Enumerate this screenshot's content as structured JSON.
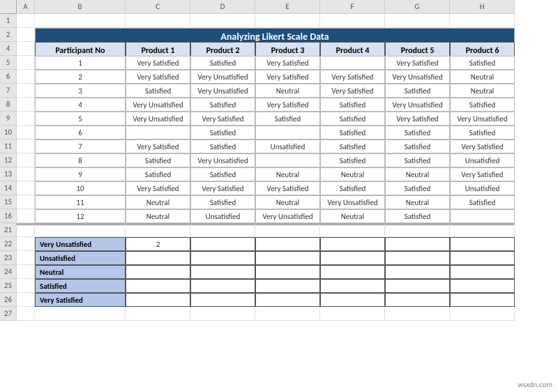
{
  "cols": [
    "A",
    "B",
    "C",
    "D",
    "E",
    "F",
    "G",
    "H"
  ],
  "title": "Analyzing Likert Scale Data",
  "headers": [
    "Participant No",
    "Product 1",
    "Product 2",
    "Product 3",
    "Product 4",
    "Product 5",
    "Product 6"
  ],
  "rows": [
    {
      "n": "1",
      "c": [
        "Very Satisfied",
        "Satisfied",
        "Very Satisfied",
        "",
        "Very Satisfied",
        "Satisfied"
      ]
    },
    {
      "n": "2",
      "c": [
        "Very Satisfied",
        "Very Unsatisfied",
        "Very Satisfied",
        "Very Satisfied",
        "Very Unsatisfied",
        "Neutral"
      ]
    },
    {
      "n": "3",
      "c": [
        "Satisfied",
        "Very Unsatisfied",
        "Neutral",
        "Very Satisfied",
        "Satisfied",
        "Neutral"
      ]
    },
    {
      "n": "4",
      "c": [
        "Very Unsatisfied",
        "Satisfied",
        "Very Satisfied",
        "Satisfied",
        "Very Unsatisfied",
        "Satisfied"
      ]
    },
    {
      "n": "5",
      "c": [
        "Very Unsatisfied",
        "Very Satisfied",
        "Satisfied",
        "Satisfied",
        "Very Satisfied",
        "Very Unsatisfied"
      ]
    },
    {
      "n": "6",
      "c": [
        "",
        "Satisfied",
        "",
        "Satisfied",
        "Satisfied",
        "Satisfied"
      ]
    },
    {
      "n": "7",
      "c": [
        "Very Satisfied",
        "Satisfied",
        "Unsatisfied",
        "Satisfied",
        "Satisfied",
        "Very Satisfied"
      ]
    },
    {
      "n": "8",
      "c": [
        "Satisfied",
        "Very Unsatisfied",
        "",
        "Satisfied",
        "Satisfied",
        "Unsatisfied"
      ]
    },
    {
      "n": "9",
      "c": [
        "Satisfied",
        "Satisfied",
        "Neutral",
        "Neutral",
        "Neutral",
        "Very Satisfied"
      ]
    },
    {
      "n": "10",
      "c": [
        "Very Satisfied",
        "Very Satisfied",
        "Very Satisfied",
        "Satisfied",
        "Satisfied",
        "Unsatisfied"
      ]
    },
    {
      "n": "11",
      "c": [
        "Neutral",
        "Satisfied",
        "Neutral",
        "Very Unsatisfied",
        "Neutral",
        "Satisfied"
      ]
    },
    {
      "n": "12",
      "c": [
        "Neutral",
        "Unsatisfied",
        "Very Unsatisfied",
        "Neutral",
        "Satisfied",
        ""
      ]
    }
  ],
  "summary_labels": [
    "Very Unsatisfied",
    "Unsatisfied",
    "Neutral",
    "Satisfied",
    "Very Satisfied"
  ],
  "summary_value": "2",
  "row_nums_main": [
    "1",
    "2",
    "4",
    "5",
    "6",
    "7",
    "8",
    "9",
    "10",
    "11",
    "12",
    "13",
    "14",
    "15",
    "16",
    "21",
    "22",
    "23",
    "24",
    "25",
    "26",
    "27"
  ],
  "watermark": "wsxdn.com"
}
